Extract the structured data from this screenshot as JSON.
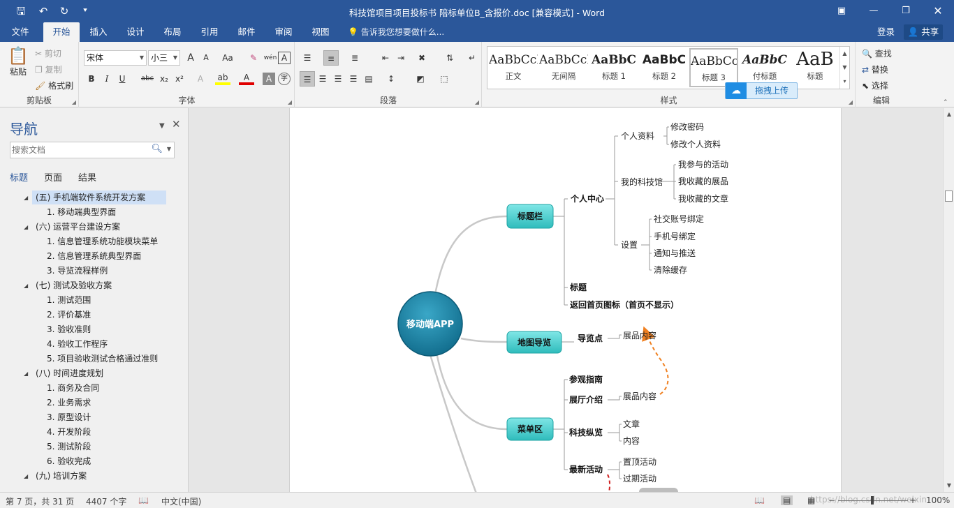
{
  "window": {
    "title": "科技馆项目项目投标书 陪标单位B_含报价.doc [兼容模式] - Word",
    "quick_access": {
      "save": "save-icon",
      "undo": "undo-icon",
      "redo": "redo-icon",
      "customize": "customize-icon"
    },
    "controls": {
      "ribbon_display": "ribbon-display-icon",
      "minimize": "minimize-icon",
      "restore": "restore-icon",
      "close": "close-icon"
    }
  },
  "ribbon_tabs": [
    "文件",
    "开始",
    "插入",
    "设计",
    "布局",
    "引用",
    "邮件",
    "审阅",
    "视图"
  ],
  "active_tab": "开始",
  "tell_me": "告诉我您想要做什么...",
  "account": {
    "login": "登录",
    "share": "共享"
  },
  "clipboard": {
    "paste": "粘贴",
    "cut": "剪切",
    "copy": "复制",
    "format_painter": "格式刷",
    "group_label": "剪贴板"
  },
  "font": {
    "name": "宋体",
    "size": "小三",
    "group_label": "字体",
    "grow": "A",
    "shrink": "A",
    "case": "Aa",
    "phonetic": "wén",
    "border_char": "A",
    "bold": "B",
    "italic": "I",
    "underline": "U",
    "strike": "abc",
    "sub": "x₂",
    "sup": "x²",
    "text_effect": "A",
    "highlight": "ab",
    "font_color": "A",
    "shading": "A",
    "enclose": "字",
    "highlight_color": "#ffff00",
    "font_color_value": "#e00000"
  },
  "paragraph": {
    "group_label": "段落"
  },
  "styles": {
    "group_label": "样式",
    "items": [
      {
        "sample": "AaBbCcDd",
        "name": "正文"
      },
      {
        "sample": "AaBbCcDd",
        "name": "无间隔"
      },
      {
        "sample": "AaBbC",
        "name": "标题 1"
      },
      {
        "sample": "AaBbC",
        "name": "标题 2"
      },
      {
        "sample": "AaBbCcDd",
        "name": "标题 3"
      },
      {
        "sample": "AaBbC",
        "name": "付标题"
      },
      {
        "sample": "AaB",
        "name": "标题"
      }
    ],
    "selected": "标题 3"
  },
  "editing": {
    "group_label": "编辑",
    "find": "查找",
    "replace": "替换",
    "select": "选择"
  },
  "upload_pill": "拖拽上传",
  "navigation": {
    "title": "导航",
    "search_placeholder": "搜索文档",
    "tabs": [
      "标题",
      "页面",
      "结果"
    ],
    "active_tab": "标题",
    "tree": [
      {
        "text": "(五) 手机端软件系统开发方案",
        "level": 1,
        "expanded": true,
        "selected": true
      },
      {
        "text": "1. 移动端典型界面",
        "level": 2
      },
      {
        "text": "(六) 运营平台建设方案",
        "level": 1,
        "expanded": true
      },
      {
        "text": "1. 信息管理系统功能模块菜单",
        "level": 2
      },
      {
        "text": "2. 信息管理系统典型界面",
        "level": 2
      },
      {
        "text": "3. 导览流程样例",
        "level": 2
      },
      {
        "text": "(七) 测试及验收方案",
        "level": 1,
        "expanded": true
      },
      {
        "text": "1. 测试范围",
        "level": 2
      },
      {
        "text": "2. 评价基准",
        "level": 2
      },
      {
        "text": "3. 验收准则",
        "level": 2
      },
      {
        "text": "4. 验收工作程序",
        "level": 2
      },
      {
        "text": "5. 项目验收测试合格通过准则",
        "level": 2
      },
      {
        "text": "(八) 时间进度规划",
        "level": 1,
        "expanded": true
      },
      {
        "text": "1. 商务及合同",
        "level": 2
      },
      {
        "text": "2. 业务需求",
        "level": 2
      },
      {
        "text": "3. 原型设计",
        "level": 2
      },
      {
        "text": "4. 开发阶段",
        "level": 2
      },
      {
        "text": "5. 测试阶段",
        "level": 2
      },
      {
        "text": "6. 验收完成",
        "level": 2
      },
      {
        "text": "(九) 培训方案",
        "level": 1,
        "expanded": true
      }
    ]
  },
  "mindmap": {
    "root": "移动端APP",
    "branches": {
      "title_bar": "标题栏",
      "map_nav": "地图导览",
      "menu": "菜单区"
    },
    "personal_center": "个人中心",
    "personal_info": "个人资料",
    "change_password": "修改密码",
    "edit_profile": "修改个人资料",
    "my_museum": "我的科技馆",
    "my_activities": "我参与的活动",
    "my_exhibits": "我收藏的展品",
    "my_articles": "我收藏的文章",
    "settings": "设置",
    "social_binding": "社交账号绑定",
    "phone_binding": "手机号绑定",
    "notify_push": "通知与推送",
    "clear_cache": "清除缓存",
    "title_label": "标题",
    "back_home_icon": "返回首页图标（首页不显示）",
    "tour_point": "导览点",
    "exhibit_content_1": "展品内容",
    "visit_guide": "参观指南",
    "hall_intro": "展厅介绍",
    "exhibit_content_2": "展品内容",
    "science_overview": "科技纵览",
    "article": "文章",
    "content": "内容",
    "latest_activity": "最新活动",
    "pinned_activity": "置顶活动",
    "expired_activity": "过期活动",
    "colors": {
      "node": "#3cc8c8",
      "root": "#15809e",
      "arrow": "#f08020",
      "arrow_red": "#d02020"
    }
  },
  "status": {
    "page": "第 7 页，共 31 页",
    "words": "4407 个字",
    "language": "中文(中国)",
    "zoom": "100%",
    "zoom_minus": "−",
    "zoom_plus": "+",
    "watermark": "https://blog.csdn.net/weixin"
  }
}
